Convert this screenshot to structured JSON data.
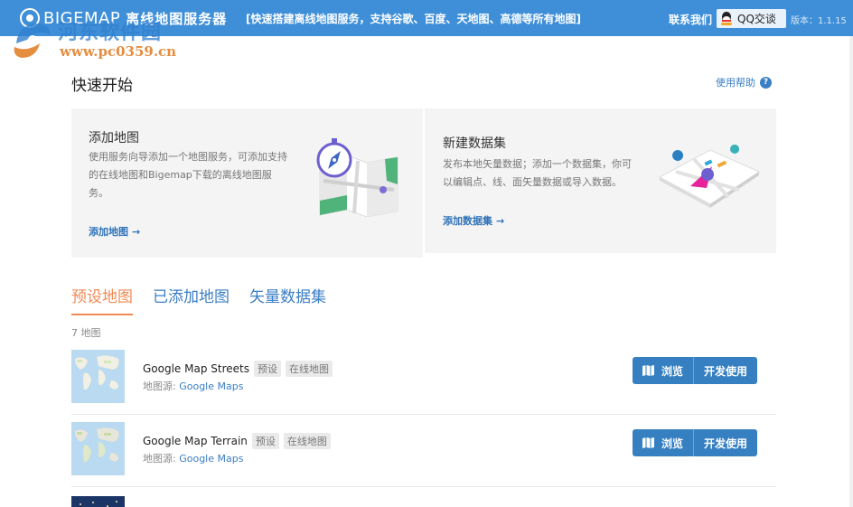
{
  "header": {
    "brand": "BIGEMAP",
    "app_name": "离线地图服务器",
    "slogan": "[快速搭建离线地图服务，支持谷歌、百度、天地图、高德等所有地图]",
    "contact": "联系我们",
    "qq_button": "QQ交谈",
    "version": "版本：1.1.15"
  },
  "watermark": {
    "title": "河东软件园",
    "url": "www.pc0359.cn"
  },
  "quick_start": {
    "title": "快速开始",
    "help": "使用帮助",
    "help_icon": "?"
  },
  "cards": {
    "add_map": {
      "title": "添加地图",
      "desc_lines": [
        "使用服务向导添加一个地图服务，可添加支持",
        "的在线地图和Bigemap下载的离线地图服",
        "务。"
      ],
      "link": "添加地图"
    },
    "new_dataset": {
      "title": "新建数据集",
      "desc_lines": [
        "发布本地矢量数据；添加一个数据集，你可",
        "以编辑点、线、面矢量数据或导入数据。"
      ],
      "link": "添加数据集"
    }
  },
  "tabs": [
    {
      "label": "预设地图",
      "active": true
    },
    {
      "label": "已添加地图",
      "active": false
    },
    {
      "label": "矢量数据集",
      "active": false
    }
  ],
  "map_count": "7 地图",
  "maps": [
    {
      "name": "Google Map Streets",
      "tags": [
        "预设",
        "在线地图"
      ],
      "source_label": "地图源:",
      "source": "Google Maps",
      "browse": "浏览",
      "develop": "开发使用"
    },
    {
      "name": "Google Map Terrain",
      "tags": [
        "预设",
        "在线地图"
      ],
      "source_label": "地图源:",
      "source": "Google Maps",
      "browse": "浏览",
      "develop": "开发使用"
    }
  ],
  "colors": {
    "header_bg": "#3f8fd8",
    "accent_orange": "#f28a54",
    "link_blue": "#3a7ec5",
    "button_blue": "#3680c2"
  }
}
